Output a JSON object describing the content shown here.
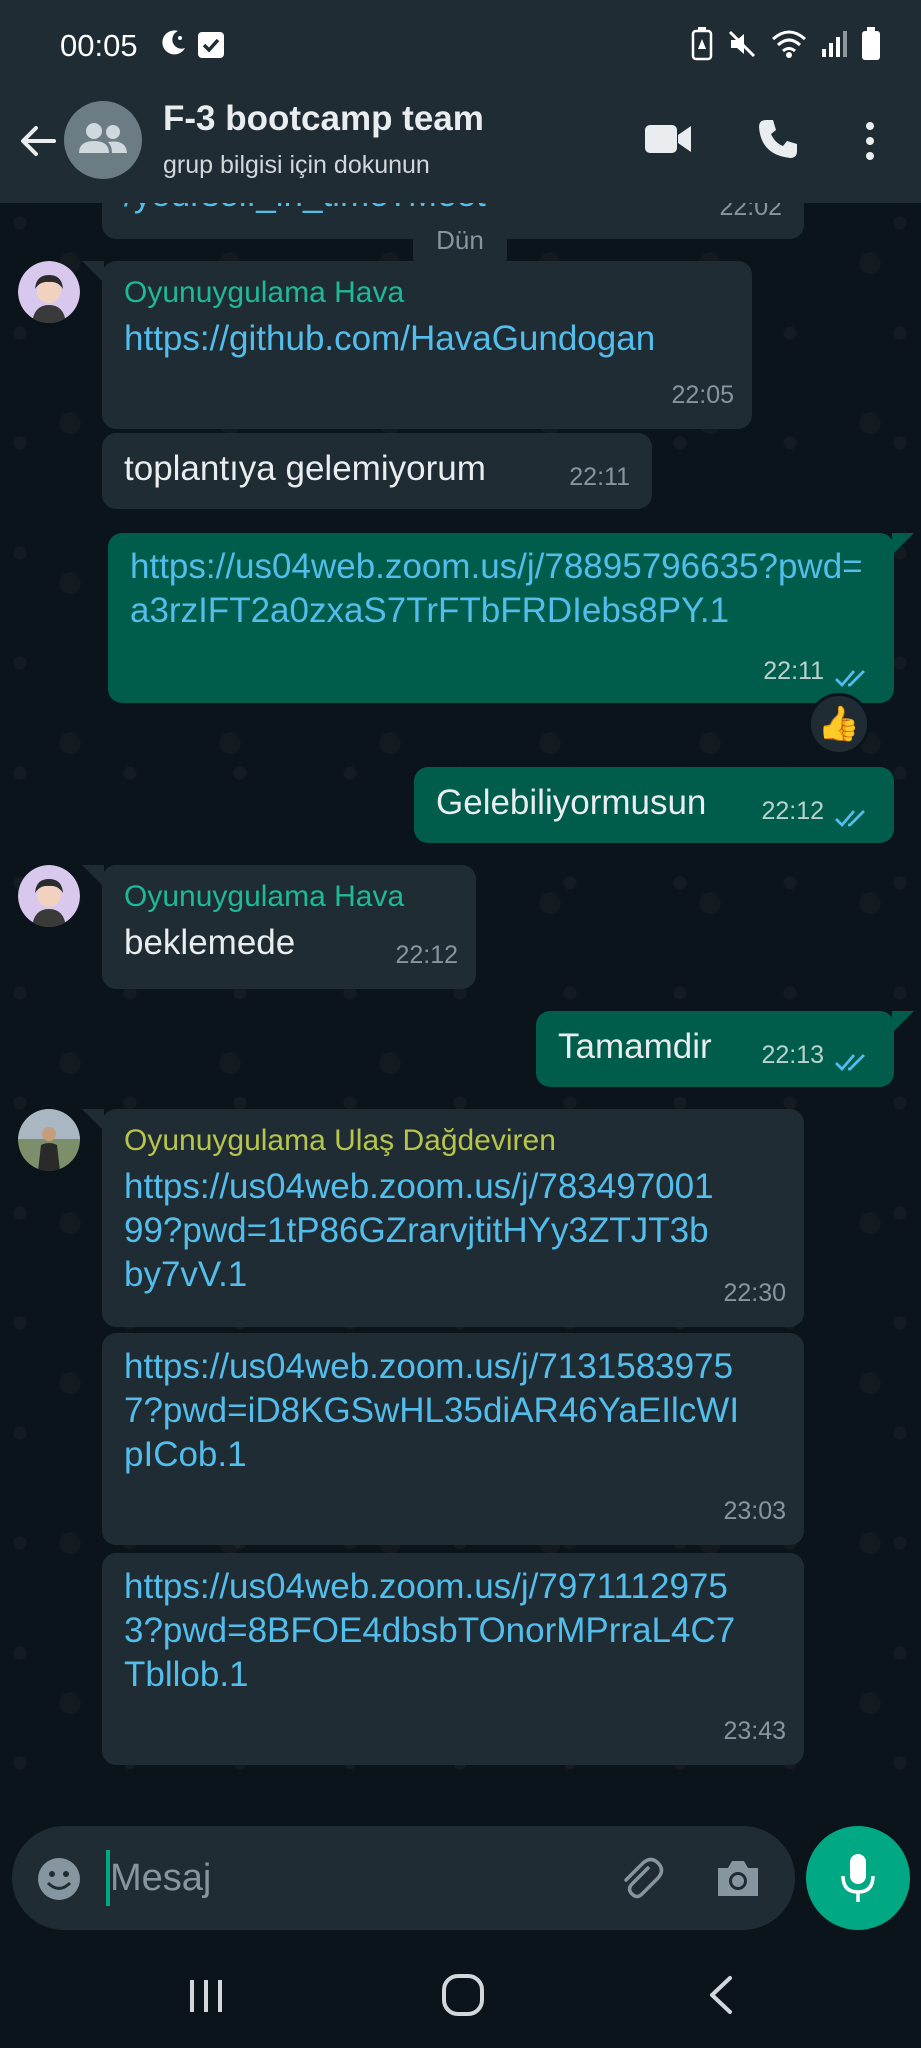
{
  "status_bar": {
    "time": "00:05",
    "icons": [
      "moon-icon",
      "check-box-icon",
      "battery-saver-icon",
      "mute-icon",
      "wifi-icon",
      "signal-icon",
      "battery-icon"
    ]
  },
  "header": {
    "title": "F-3 bootcamp team",
    "subtitle": "grup bilgisi için dokunun",
    "icons": [
      "back-arrow-icon",
      "group-avatar-icon",
      "video-call-icon",
      "voice-call-icon",
      "more-options-icon"
    ]
  },
  "chat": {
    "date_chip": "Dün",
    "partial_message": {
      "text": "/yourself_in_time?Meet",
      "time": "22:02"
    },
    "messages": [
      {
        "sender": "Oyunuygulama Hava",
        "text": "https://github.com/HavaGundogan",
        "time": "22:05",
        "direction": "in",
        "is_link": true
      },
      {
        "text": "toplantıya gelemiyorum",
        "time": "22:11",
        "direction": "in"
      },
      {
        "text": "https://us04web.zoom.us/j/78895796635?pwd=a3rzIFT2a0zxaS7TrFTbFRDIebs8PY.1",
        "time": "22:11",
        "direction": "out",
        "is_link": true,
        "reaction": "👍"
      },
      {
        "text": "Gelebiliyormusun",
        "time": "22:12",
        "direction": "out"
      },
      {
        "sender": "Oyunuygulama Hava",
        "text": "beklemede",
        "time": "22:12",
        "direction": "in"
      },
      {
        "text": "Tamamdir",
        "time": "22:13",
        "direction": "out"
      },
      {
        "sender": "Oyunuygulama Ulaş Dağdeviren",
        "text": "https://us04web.zoom.us/j/78349700199?pwd=1tP86GZrarvjtitHYy3ZTJT3bby7vV.1",
        "time": "22:30",
        "direction": "in",
        "is_link": true
      },
      {
        "text": "https://us04web.zoom.us/j/71315839757?pwd=iD8KGSwHL35diAR46YaEIlcWIpICob.1",
        "time": "23:03",
        "direction": "in",
        "is_link": true
      },
      {
        "text": "https://us04web.zoom.us/j/79711129753?pwd=8BFOE4dbsbTOnorMPrraL4C7Tbllob.1",
        "time": "23:43",
        "direction": "in",
        "is_link": true
      }
    ]
  },
  "input_bar": {
    "placeholder": "Mesaj",
    "icons": [
      "emoji-icon",
      "attach-icon",
      "camera-icon",
      "mic-icon"
    ]
  },
  "nav_bar": {
    "icons": [
      "recents-icon",
      "home-icon",
      "back-icon"
    ]
  },
  "colors": {
    "background": "#0b141a",
    "header": "#1f2c34",
    "incoming_bubble": "#1f2c34",
    "outgoing_bubble": "#005c4b",
    "link": "#53bdeb",
    "accent": "#00a884",
    "sender_hava": "#1fb997",
    "sender_ulas": "#b8c44a",
    "read_ticks": "#53bdeb"
  }
}
